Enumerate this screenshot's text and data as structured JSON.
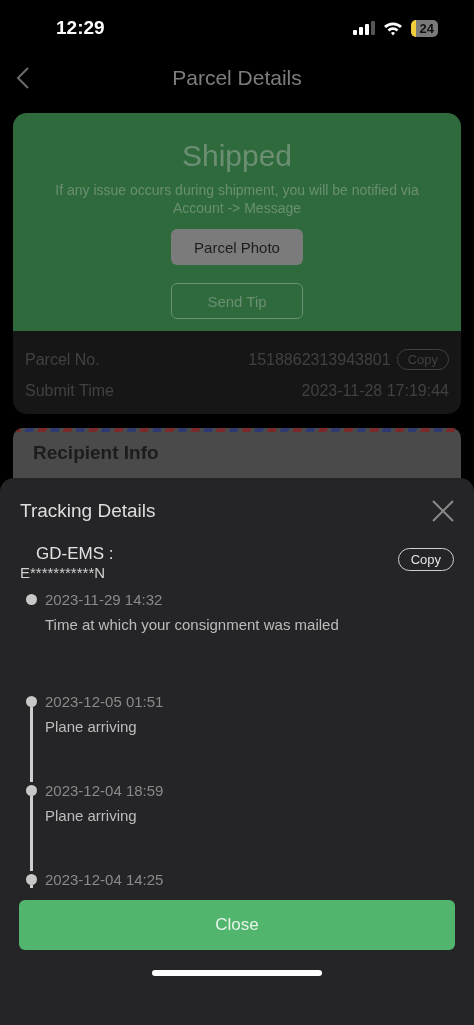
{
  "status_bar": {
    "time": "12:29",
    "battery": "24"
  },
  "nav": {
    "title": "Parcel Details"
  },
  "status_card": {
    "status": "Shipped",
    "message": "If any issue occurs during shipment, you will be notified via Account -> Message",
    "photo_button": "Parcel Photo",
    "tip_button": "Send Tip",
    "rows": [
      {
        "label": "Parcel No.",
        "value": "1518862313943801",
        "copy": "Copy"
      },
      {
        "label": "Submit Time",
        "value": "2023-11-28 17:19:44"
      }
    ]
  },
  "recipient_card": {
    "title": "Recipient Info"
  },
  "tracking_sheet": {
    "title": "Tracking Details",
    "carrier": "GD-EMS :",
    "tracking_number": "E***********N",
    "copy": "Copy",
    "events": [
      {
        "time": "2023-11-29 14:32",
        "text": "Time at which your consignment was mailed"
      },
      {
        "time": "2023-12-05 01:51",
        "text": "Plane arriving"
      },
      {
        "time": "2023-12-04 18:59",
        "text": "Plane arriving"
      },
      {
        "time": "2023-12-04 14:25"
      }
    ],
    "close_button": "Close"
  }
}
